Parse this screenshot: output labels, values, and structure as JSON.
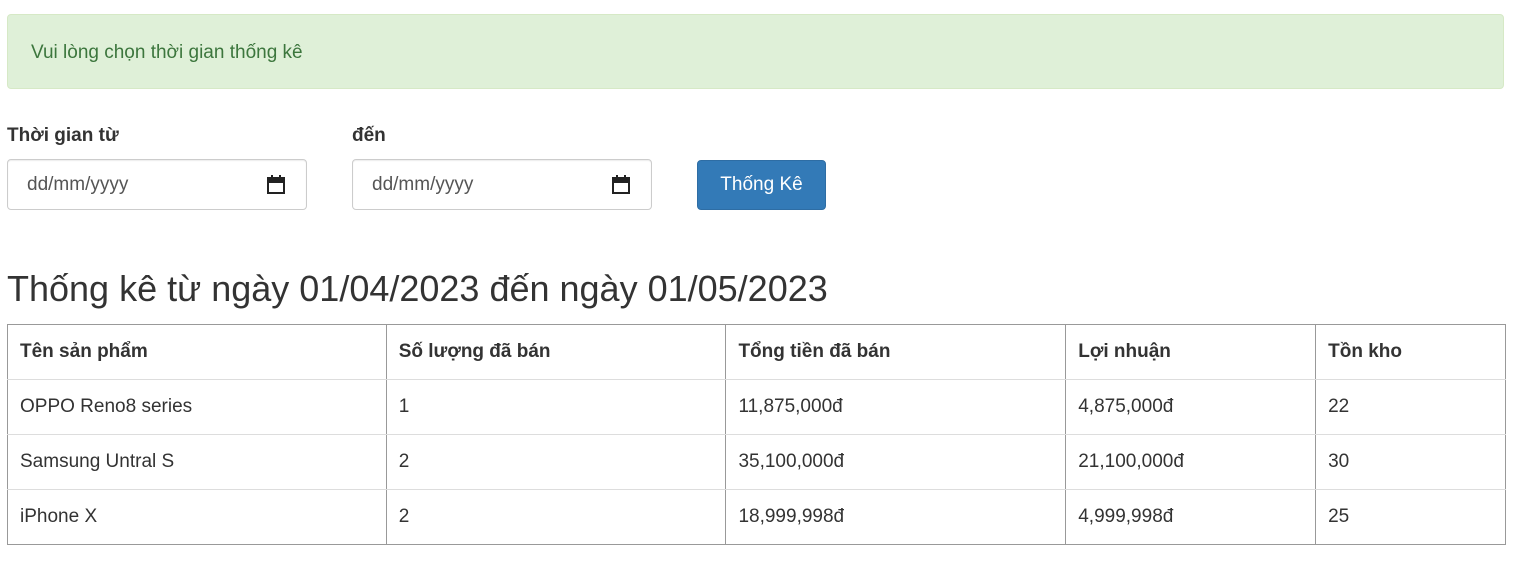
{
  "alert": {
    "message": "Vui lòng chọn thời gian thống kê",
    "color": "#3c763d",
    "background": "#dff0d8"
  },
  "filter": {
    "from_label": "Thời gian từ",
    "from_placeholder": "dd/mm/yyyy",
    "to_label": "đến",
    "to_placeholder": "dd/mm/yyyy",
    "icon": "calendar-icon",
    "submit_label": "Thống Kê",
    "submit_color": "#337ab7"
  },
  "report": {
    "title": "Thống kê từ ngày 01/04/2023 đến ngày 01/05/2023",
    "columns": [
      "Tên sản phẩm",
      "Số lượng đã bán",
      "Tổng tiền đã bán",
      "Lợi nhuận",
      "Tồn kho"
    ],
    "rows": [
      [
        "OPPO Reno8 series",
        "1",
        "11,875,000đ",
        "4,875,000đ",
        "22"
      ],
      [
        "Samsung Untral S",
        "2",
        "35,100,000đ",
        "21,100,000đ",
        "30"
      ],
      [
        "iPhone X",
        "2",
        "18,999,998đ",
        "4,999,998đ",
        "25"
      ]
    ]
  }
}
